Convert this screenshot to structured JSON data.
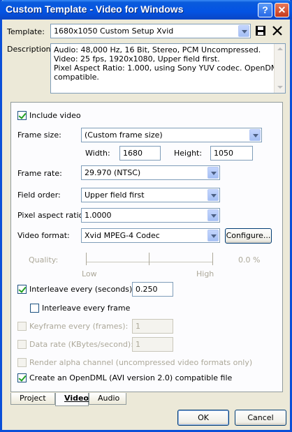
{
  "window": {
    "title": "Custom Template - Video for Windows"
  },
  "template": {
    "label": "Template:",
    "value": "1680x1050 Custom Setup Xvid"
  },
  "description": {
    "label": "Description:",
    "text_lines": [
      "Audio: 48,000 Hz, 16 Bit, Stereo, PCM Uncompressed.",
      "Video: 25 fps, 1920x1080, Upper field first.",
      "Pixel Aspect Ratio: 1.000, using Sony YUV codec. OpenDML",
      "compatible."
    ]
  },
  "video": {
    "include_video": {
      "label": "Include video",
      "checked": true
    },
    "frame_size": {
      "label": "Frame size:",
      "value": "(Custom frame size)"
    },
    "width": {
      "label": "Width:",
      "value": "1680"
    },
    "height": {
      "label": "Height:",
      "value": "1050"
    },
    "frame_rate": {
      "label": "Frame rate:",
      "value": "29.970 (NTSC)"
    },
    "field_order": {
      "label": "Field order:",
      "value": "Upper field first"
    },
    "pixel_aspect_ratio": {
      "label": "Pixel aspect ratio:",
      "value": "1.0000"
    },
    "video_format": {
      "label": "Video format:",
      "value": "Xvid MPEG-4 Codec"
    },
    "configure_label": "Configure...",
    "quality": {
      "label": "Quality:",
      "low": "Low",
      "high": "High",
      "percent": "0.0 %"
    },
    "interleave_seconds": {
      "label": "Interleave every (seconds):",
      "value": "0.250",
      "checked": true
    },
    "interleave_frame": {
      "label": "Interleave every frame",
      "checked": false
    },
    "keyframe": {
      "label": "Keyframe every (frames):",
      "value": "1"
    },
    "data_rate": {
      "label": "Data rate (KBytes/second):",
      "value": "1"
    },
    "render_alpha": {
      "label": "Render alpha channel (uncompressed video formats only)"
    },
    "opendml": {
      "label": "Create an OpenDML (AVI version 2.0) compatible file",
      "checked": true
    }
  },
  "tabs": [
    "Project",
    "Video",
    "Audio"
  ],
  "buttons": {
    "ok": "OK",
    "cancel": "Cancel"
  }
}
